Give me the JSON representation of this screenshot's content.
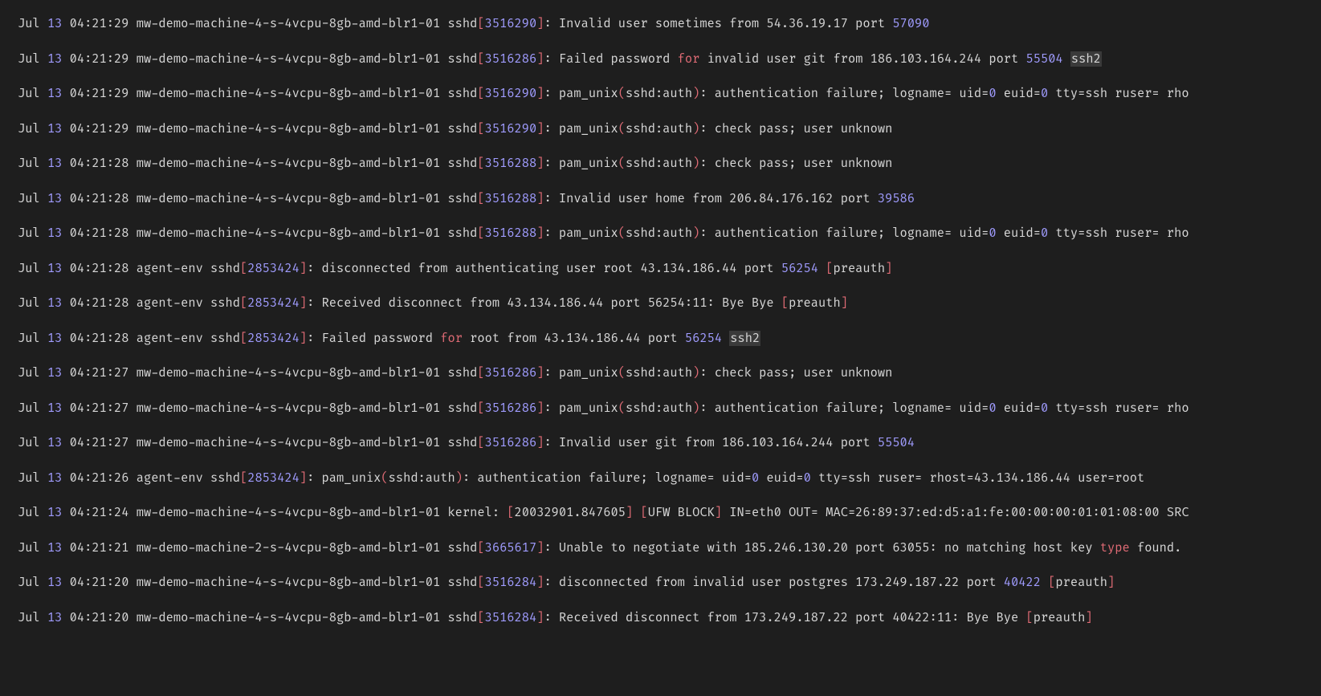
{
  "lines": [
    {
      "month": "Jul",
      "day": "13",
      "time": "04:21:29",
      "host": "mw-demo-machine-4-s-4vcpu-8gb-amd-blr1-01",
      "proc": "sshd",
      "pid": "3516290",
      "tokens": [
        {
          "cls": "tok-text",
          "t": " Invalid user sometimes from 54.36.19.17 port "
        },
        {
          "cls": "tok-num",
          "t": "57090"
        }
      ]
    },
    {
      "month": "Jul",
      "day": "13",
      "time": "04:21:29",
      "host": "mw-demo-machine-4-s-4vcpu-8gb-amd-blr1-01",
      "proc": "sshd",
      "pid": "3516286",
      "tokens": [
        {
          "cls": "tok-text",
          "t": " Failed password "
        },
        {
          "cls": "tok-kw",
          "t": "for"
        },
        {
          "cls": "tok-text",
          "t": " invalid user git from 186.103.164.244 port "
        },
        {
          "cls": "tok-num",
          "t": "55504"
        },
        {
          "cls": "tok-text",
          "t": " "
        },
        {
          "cls": "tok-hl",
          "t": "ssh2"
        }
      ]
    },
    {
      "month": "Jul",
      "day": "13",
      "time": "04:21:29",
      "host": "mw-demo-machine-4-s-4vcpu-8gb-amd-blr1-01",
      "proc": "sshd",
      "pid": "3516290",
      "tokens": [
        {
          "cls": "tok-text",
          "t": " pam_unix"
        },
        {
          "cls": "tok-pn",
          "t": "("
        },
        {
          "cls": "tok-text",
          "t": "sshd:auth"
        },
        {
          "cls": "tok-pn",
          "t": ")"
        },
        {
          "cls": "tok-text",
          "t": ": authentication failure; logname= uid="
        },
        {
          "cls": "tok-num",
          "t": "0"
        },
        {
          "cls": "tok-text",
          "t": " euid="
        },
        {
          "cls": "tok-num",
          "t": "0"
        },
        {
          "cls": "tok-text",
          "t": " tty=ssh ruser= rho"
        }
      ]
    },
    {
      "month": "Jul",
      "day": "13",
      "time": "04:21:29",
      "host": "mw-demo-machine-4-s-4vcpu-8gb-amd-blr1-01",
      "proc": "sshd",
      "pid": "3516290",
      "tokens": [
        {
          "cls": "tok-text",
          "t": " pam_unix"
        },
        {
          "cls": "tok-pn",
          "t": "("
        },
        {
          "cls": "tok-text",
          "t": "sshd:auth"
        },
        {
          "cls": "tok-pn",
          "t": ")"
        },
        {
          "cls": "tok-text",
          "t": ": check pass; user unknown"
        }
      ]
    },
    {
      "month": "Jul",
      "day": "13",
      "time": "04:21:28",
      "host": "mw-demo-machine-4-s-4vcpu-8gb-amd-blr1-01",
      "proc": "sshd",
      "pid": "3516288",
      "tokens": [
        {
          "cls": "tok-text",
          "t": " pam_unix"
        },
        {
          "cls": "tok-pn",
          "t": "("
        },
        {
          "cls": "tok-text",
          "t": "sshd:auth"
        },
        {
          "cls": "tok-pn",
          "t": ")"
        },
        {
          "cls": "tok-text",
          "t": ": check pass; user unknown"
        }
      ]
    },
    {
      "month": "Jul",
      "day": "13",
      "time": "04:21:28",
      "host": "mw-demo-machine-4-s-4vcpu-8gb-amd-blr1-01",
      "proc": "sshd",
      "pid": "3516288",
      "tokens": [
        {
          "cls": "tok-text",
          "t": " Invalid user home from 206.84.176.162 port "
        },
        {
          "cls": "tok-num",
          "t": "39586"
        }
      ]
    },
    {
      "month": "Jul",
      "day": "13",
      "time": "04:21:28",
      "host": "mw-demo-machine-4-s-4vcpu-8gb-amd-blr1-01",
      "proc": "sshd",
      "pid": "3516288",
      "tokens": [
        {
          "cls": "tok-text",
          "t": " pam_unix"
        },
        {
          "cls": "tok-pn",
          "t": "("
        },
        {
          "cls": "tok-text",
          "t": "sshd:auth"
        },
        {
          "cls": "tok-pn",
          "t": ")"
        },
        {
          "cls": "tok-text",
          "t": ": authentication failure; logname= uid="
        },
        {
          "cls": "tok-num",
          "t": "0"
        },
        {
          "cls": "tok-text",
          "t": " euid="
        },
        {
          "cls": "tok-num",
          "t": "0"
        },
        {
          "cls": "tok-text",
          "t": " tty=ssh ruser= rho"
        }
      ]
    },
    {
      "month": "Jul",
      "day": "13",
      "time": "04:21:28",
      "host": "agent-env",
      "proc": "sshd",
      "pid": "2853424",
      "tokens": [
        {
          "cls": "tok-text",
          "t": " disconnected from authenticating user root 43.134.186.44 port "
        },
        {
          "cls": "tok-num",
          "t": "56254"
        },
        {
          "cls": "tok-text",
          "t": " "
        },
        {
          "cls": "tok-br",
          "t": "["
        },
        {
          "cls": "tok-text",
          "t": "preauth"
        },
        {
          "cls": "tok-br",
          "t": "]"
        }
      ]
    },
    {
      "month": "Jul",
      "day": "13",
      "time": "04:21:28",
      "host": "agent-env",
      "proc": "sshd",
      "pid": "2853424",
      "tokens": [
        {
          "cls": "tok-text",
          "t": " Received disconnect from 43.134.186.44 port 56254:11: Bye Bye "
        },
        {
          "cls": "tok-br",
          "t": "["
        },
        {
          "cls": "tok-text",
          "t": "preauth"
        },
        {
          "cls": "tok-br",
          "t": "]"
        }
      ]
    },
    {
      "month": "Jul",
      "day": "13",
      "time": "04:21:28",
      "host": "agent-env",
      "proc": "sshd",
      "pid": "2853424",
      "tokens": [
        {
          "cls": "tok-text",
          "t": " Failed password "
        },
        {
          "cls": "tok-kw",
          "t": "for"
        },
        {
          "cls": "tok-text",
          "t": " root from 43.134.186.44 port "
        },
        {
          "cls": "tok-num",
          "t": "56254"
        },
        {
          "cls": "tok-text",
          "t": " "
        },
        {
          "cls": "tok-hl",
          "t": "ssh2"
        }
      ]
    },
    {
      "month": "Jul",
      "day": "13",
      "time": "04:21:27",
      "host": "mw-demo-machine-4-s-4vcpu-8gb-amd-blr1-01",
      "proc": "sshd",
      "pid": "3516286",
      "tokens": [
        {
          "cls": "tok-text",
          "t": " pam_unix"
        },
        {
          "cls": "tok-pn",
          "t": "("
        },
        {
          "cls": "tok-text",
          "t": "sshd:auth"
        },
        {
          "cls": "tok-pn",
          "t": ")"
        },
        {
          "cls": "tok-text",
          "t": ": check pass; user unknown"
        }
      ]
    },
    {
      "month": "Jul",
      "day": "13",
      "time": "04:21:27",
      "host": "mw-demo-machine-4-s-4vcpu-8gb-amd-blr1-01",
      "proc": "sshd",
      "pid": "3516286",
      "tokens": [
        {
          "cls": "tok-text",
          "t": " pam_unix"
        },
        {
          "cls": "tok-pn",
          "t": "("
        },
        {
          "cls": "tok-text",
          "t": "sshd:auth"
        },
        {
          "cls": "tok-pn",
          "t": ")"
        },
        {
          "cls": "tok-text",
          "t": ": authentication failure; logname= uid="
        },
        {
          "cls": "tok-num",
          "t": "0"
        },
        {
          "cls": "tok-text",
          "t": " euid="
        },
        {
          "cls": "tok-num",
          "t": "0"
        },
        {
          "cls": "tok-text",
          "t": " tty=ssh ruser= rho"
        }
      ]
    },
    {
      "month": "Jul",
      "day": "13",
      "time": "04:21:27",
      "host": "mw-demo-machine-4-s-4vcpu-8gb-amd-blr1-01",
      "proc": "sshd",
      "pid": "3516286",
      "tokens": [
        {
          "cls": "tok-text",
          "t": " Invalid user git from 186.103.164.244 port "
        },
        {
          "cls": "tok-num",
          "t": "55504"
        }
      ]
    },
    {
      "month": "Jul",
      "day": "13",
      "time": "04:21:26",
      "host": "agent-env",
      "proc": "sshd",
      "pid": "2853424",
      "tokens": [
        {
          "cls": "tok-text",
          "t": " pam_unix"
        },
        {
          "cls": "tok-pn",
          "t": "("
        },
        {
          "cls": "tok-text",
          "t": "sshd:auth"
        },
        {
          "cls": "tok-pn",
          "t": ")"
        },
        {
          "cls": "tok-text",
          "t": ": authentication failure; logname= uid="
        },
        {
          "cls": "tok-num",
          "t": "0"
        },
        {
          "cls": "tok-text",
          "t": " euid="
        },
        {
          "cls": "tok-num",
          "t": "0"
        },
        {
          "cls": "tok-text",
          "t": " tty=ssh ruser= rhost=43.134.186.44 user=root"
        }
      ]
    },
    {
      "month": "Jul",
      "day": "13",
      "time": "04:21:24",
      "host": "mw-demo-machine-4-s-4vcpu-8gb-amd-blr1-01",
      "proc": "kernel",
      "pid": null,
      "tokens": [
        {
          "cls": "tok-text",
          "t": " "
        },
        {
          "cls": "tok-br",
          "t": "["
        },
        {
          "cls": "tok-text",
          "t": "20032901.847605"
        },
        {
          "cls": "tok-br",
          "t": "]"
        },
        {
          "cls": "tok-text",
          "t": " "
        },
        {
          "cls": "tok-br",
          "t": "["
        },
        {
          "cls": "tok-text",
          "t": "UFW BLOCK"
        },
        {
          "cls": "tok-br",
          "t": "]"
        },
        {
          "cls": "tok-text",
          "t": " IN=eth0 OUT= MAC=26:89:37:ed:d5:a1:fe:00:00:00:01:01:08:00 SRC"
        }
      ]
    },
    {
      "month": "Jul",
      "day": "13",
      "time": "04:21:21",
      "host": "mw-demo-machine-2-s-4vcpu-8gb-amd-blr1-01",
      "proc": "sshd",
      "pid": "3665617",
      "tokens": [
        {
          "cls": "tok-text",
          "t": " Unable to negotiate with 185.246.130.20 port 63055: no matching host key "
        },
        {
          "cls": "tok-kw",
          "t": "type"
        },
        {
          "cls": "tok-text",
          "t": " found."
        }
      ]
    },
    {
      "month": "Jul",
      "day": "13",
      "time": "04:21:20",
      "host": "mw-demo-machine-4-s-4vcpu-8gb-amd-blr1-01",
      "proc": "sshd",
      "pid": "3516284",
      "tokens": [
        {
          "cls": "tok-text",
          "t": " disconnected from invalid user postgres 173.249.187.22 port "
        },
        {
          "cls": "tok-num",
          "t": "40422"
        },
        {
          "cls": "tok-text",
          "t": " "
        },
        {
          "cls": "tok-br",
          "t": "["
        },
        {
          "cls": "tok-text",
          "t": "preauth"
        },
        {
          "cls": "tok-br",
          "t": "]"
        }
      ]
    },
    {
      "month": "Jul",
      "day": "13",
      "time": "04:21:20",
      "host": "mw-demo-machine-4-s-4vcpu-8gb-amd-blr1-01",
      "proc": "sshd",
      "pid": "3516284",
      "tokens": [
        {
          "cls": "tok-text",
          "t": " Received disconnect from 173.249.187.22 port 40422:11: Bye Bye "
        },
        {
          "cls": "tok-br",
          "t": "["
        },
        {
          "cls": "tok-text",
          "t": "preauth"
        },
        {
          "cls": "tok-br",
          "t": "]"
        }
      ]
    }
  ]
}
